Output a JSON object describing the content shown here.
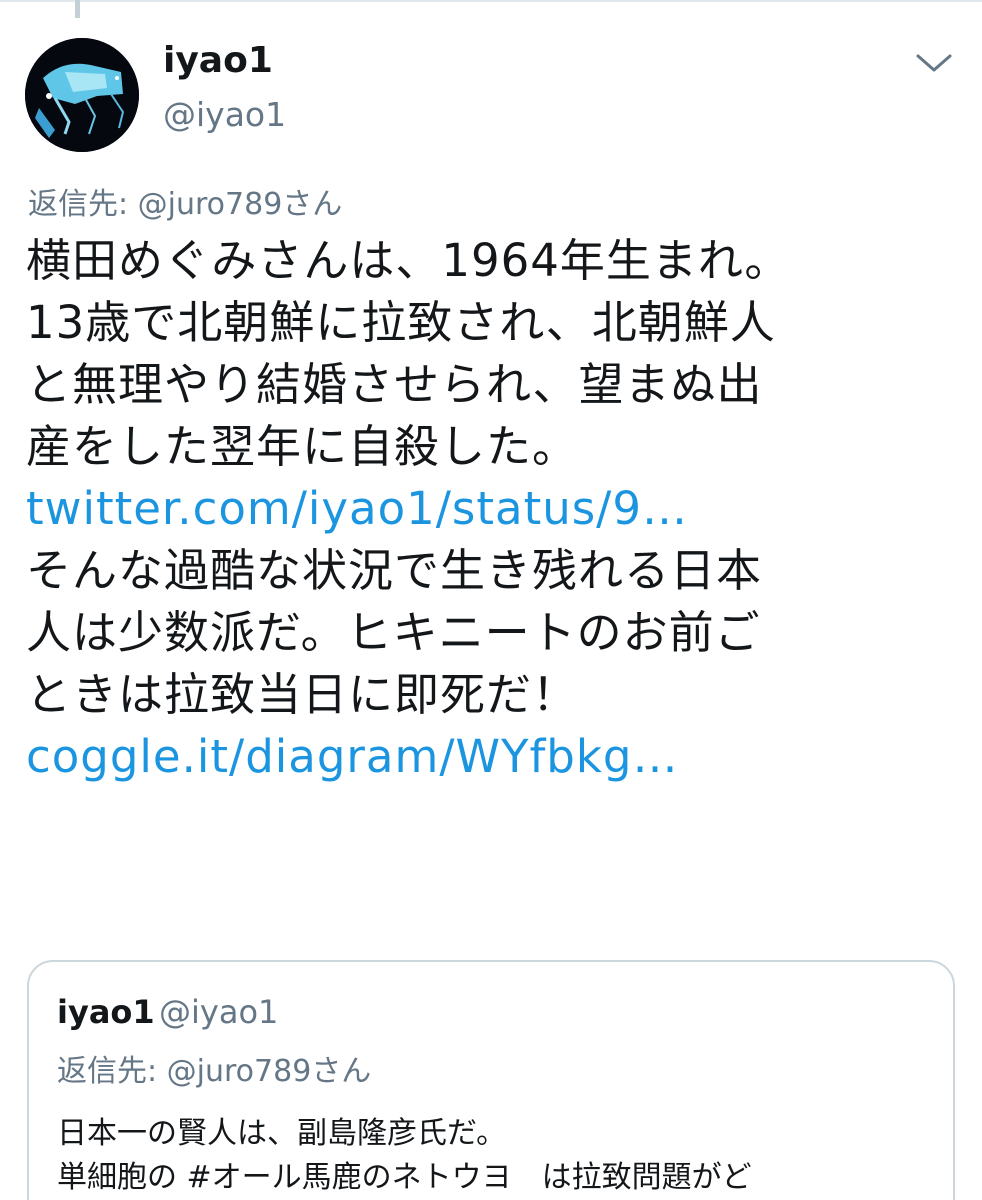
{
  "tweet": {
    "display_name": "iyao1",
    "handle": "@iyao1",
    "reply_to_prefix": "返信先: ",
    "reply_to_user": "@juro789さん",
    "text_lines": [
      "横田めぐみさんは、1964年生まれ。",
      "13歳で北朝鮮に拉致され、北朝鮮人",
      "と無理やり結婚させられ、望まぬ出",
      "産をした翌年に自殺した。"
    ],
    "link_1": "twitter.com/iyao1/status/9…",
    "text_lines_2": [
      "そんな過酷な状況で生き残れる日本",
      "人は少数派だ。ヒキニートのお前ご",
      "ときは拉致当日に即死だ！"
    ],
    "link_2": "coggle.it/diagram/WYfbkg…"
  },
  "quoted_tweet": {
    "display_name": "iyao1",
    "handle": "@iyao1",
    "reply_to_prefix": "返信先: ",
    "reply_to_user": "@juro789さん",
    "text_lines": [
      "日本一の賢人は、副島隆彦氏だ。",
      "単細胞の #オール馬鹿のネトウヨ　は拉致問題がど"
    ]
  },
  "icons": {
    "avatar": "avatar-image",
    "menu": "chevron-down-icon"
  },
  "colors": {
    "link": "#1b95e0",
    "secondary_text": "#657786",
    "primary_text": "#14171a",
    "border": "#ccd6dd"
  }
}
